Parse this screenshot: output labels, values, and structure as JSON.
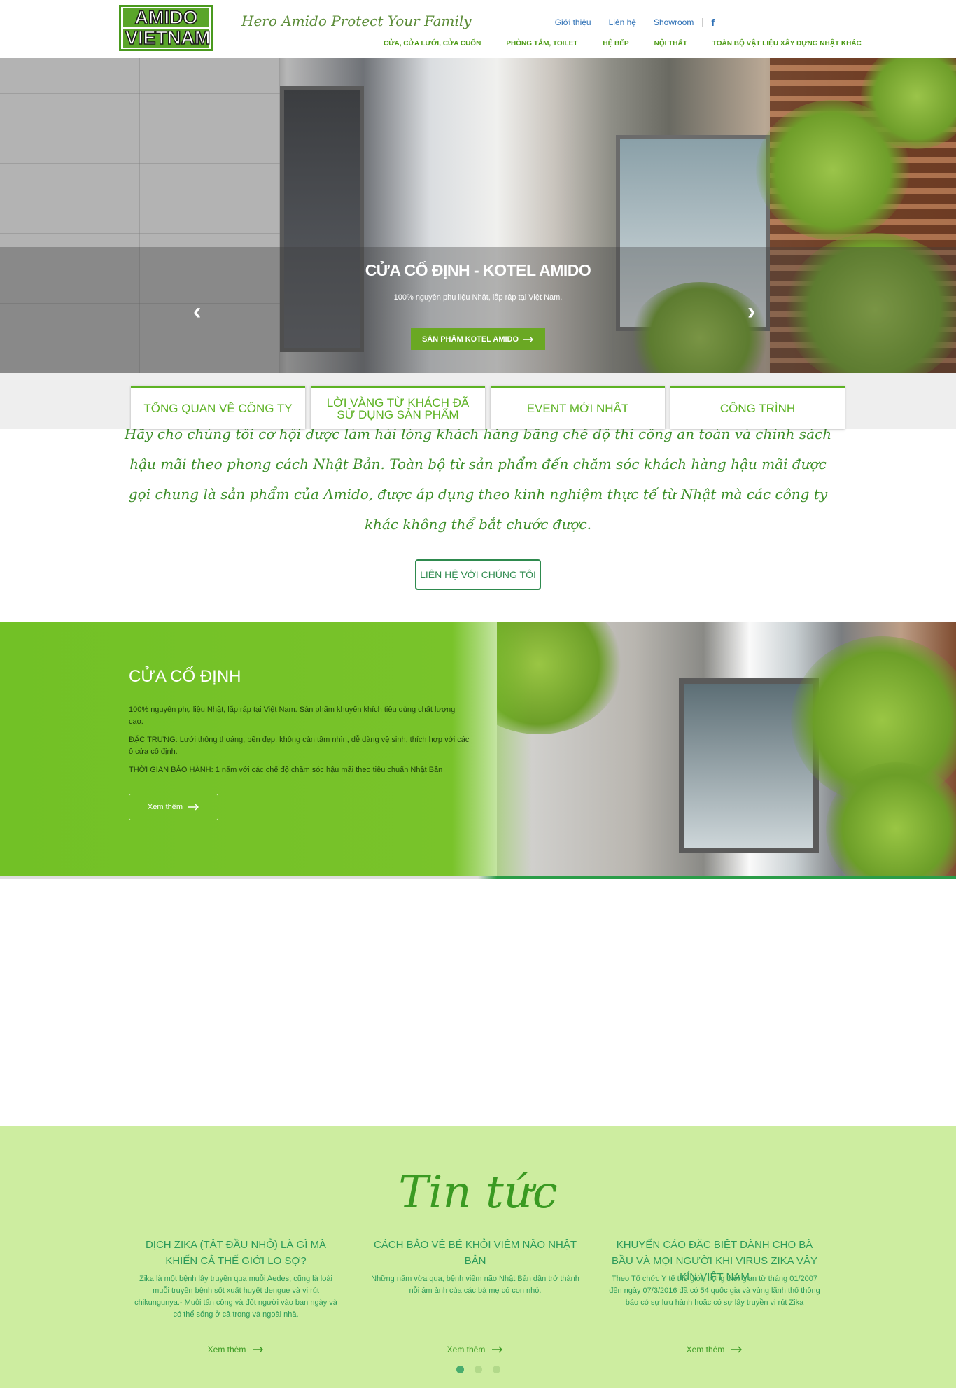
{
  "header": {
    "logo_line1": "AMIDO",
    "logo_line2": "VIETNAM",
    "tagline": "Hero Amido Protect Your Family",
    "top_links": [
      "Giới thiệu",
      "Liên hệ",
      "Showroom"
    ],
    "facebook": "f",
    "nav": [
      "CỬA, CỬA LƯỚI, CỬA CUỐN",
      "PHÒNG TẮM, TOILET",
      "HỆ BẾP",
      "NỘI THẤT",
      "TOÀN BỘ VẬT LIỆU XÂY DỰNG NHẬT KHÁC"
    ]
  },
  "hero": {
    "title": "CỬA CỐ ĐỊNH - KOTEL AMIDO",
    "subtitle": "100% nguyên phụ liệu Nhật, lắp ráp tại Việt Nam.",
    "button": "SẢN PHẨM KOTEL AMIDO",
    "prev": "‹",
    "next": "›"
  },
  "tabs": [
    "TỔNG QUAN VỀ CÔNG TY",
    "LỜI VÀNG TỪ KHÁCH ĐÃ SỬ DỤNG SẢN PHẨM",
    "EVENT MỚI NHẤT",
    "CÔNG TRÌNH"
  ],
  "quote": {
    "text": "Hãy cho chúng tôi cơ hội được làm hài lòng khách hàng bằng chế độ thi công an toàn và chính sách hậu mãi theo phong cách Nhật Bản. Toàn bộ từ sản phẩm đến chăm sóc khách hàng hậu mãi được gọi chung là sản phẩm của Amido, được áp dụng theo kinh nghiệm thực tế từ Nhật mà các công ty khác không thể bắt chước được.",
    "button": "LIÊN HỆ VỚI CHÚNG TÔI"
  },
  "product": {
    "title": "CỬA CỐ ĐỊNH",
    "paragraphs": [
      "100% nguyên phụ liệu Nhật, lắp ráp tại Việt Nam. Sản phẩm khuyến khích tiêu dùng chất lượng cao.",
      "ĐẶC TRƯNG: Lưới thông thoáng, bền đẹp, không cản tầm nhìn, dễ dàng vệ sinh, thích hợp với các ô cửa cố định.",
      "THỜI GIAN BẢO HÀNH: 1 năm với các chế độ chăm sóc hậu mãi theo tiêu chuẩn Nhật Bản"
    ],
    "button": "Xem thêm"
  },
  "news": {
    "title": "Tin tức",
    "items": [
      {
        "title": "DỊCH ZIKA (TẬT ĐẦU NHỎ) LÀ GÌ MÀ KHIẾN CẢ THẾ GIỚI LO SỢ?",
        "body": "Zika là một bệnh lây truyền qua muỗi Aedes, cũng là loài muỗi truyền bệnh sốt xuất huyết dengue và vi rút chikungunya.- Muỗi tấn công và đốt người vào ban ngày và có thể sống ở cả trong và ngoài nhà.",
        "more": "Xem thêm"
      },
      {
        "title": "CÁCH BẢO VỆ BÉ KHỎI VIÊM NÃO NHẬT BẢN",
        "body": "Những năm vừa qua, bệnh viêm não Nhật Bản dần trở thành nỗi ám ảnh của các bà mẹ có con nhỏ.",
        "more": "Xem thêm"
      },
      {
        "title": "KHUYẾN CÁO ĐẶC BIỆT DÀNH CHO BÀ BẦU VÀ MỌI NGƯỜI KHI VIRUS ZIKA VÂY KÍN VIỆT NAM",
        "body": "Theo Tổ chức Y tế thế giới, trong thời gian từ tháng 01/2007 đến ngày 07/3/2016 đã có 54 quốc gia và vùng lãnh thổ thông báo có sự lưu hành hoặc có sự lây truyền vi rút Zika",
        "more": "Xem thêm"
      }
    ],
    "dots_total": 3,
    "dots_active": 1
  },
  "colors": {
    "brand_green": "#5db224",
    "nav_blue": "#2c6fb5",
    "news_bg": "#cdeda0"
  }
}
